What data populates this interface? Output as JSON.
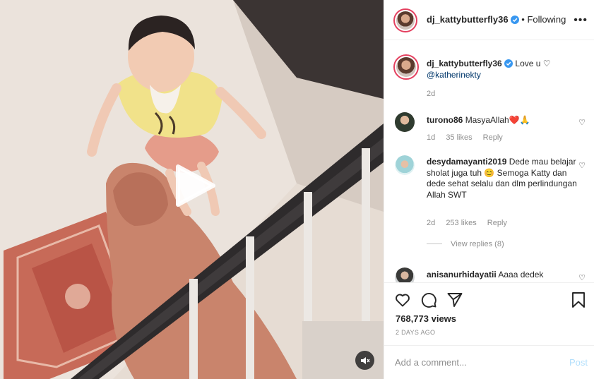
{
  "post": {
    "username": "dj_kattybutterfly36",
    "follow_status": "Following",
    "more_icon": "more-horizontal-icon",
    "caption": {
      "username": "dj_kattybutterfly36",
      "text": "Love u ♡",
      "mention": "@katherinekty",
      "age": "2d"
    }
  },
  "comments": [
    {
      "username": "turono86",
      "text": "MasyaAllah❤️🙏",
      "age": "1d",
      "likes": "35 likes",
      "reply": "Reply"
    },
    {
      "username": "desydamayanti2019",
      "text": "Dede mau belajar sholat juga tuh 😊 Semoga Katty dan dede sehat selalu dan dlm perlindungan Allah SWT",
      "age": "2d",
      "likes": "253 likes",
      "reply": "Reply",
      "view_replies": "View replies (8)"
    },
    {
      "username": "anisanurhidayatii",
      "text": "Aaaa dedek"
    }
  ],
  "stats": {
    "views": "768,773 views",
    "posted": "2 DAYS AGO"
  },
  "composer": {
    "placeholder": "Add a comment...",
    "post_label": "Post"
  },
  "colors": {
    "verified": "#3897f0",
    "link": "#00376b",
    "post_disabled": "#b2dffc",
    "muted": "#8e8e8e"
  }
}
